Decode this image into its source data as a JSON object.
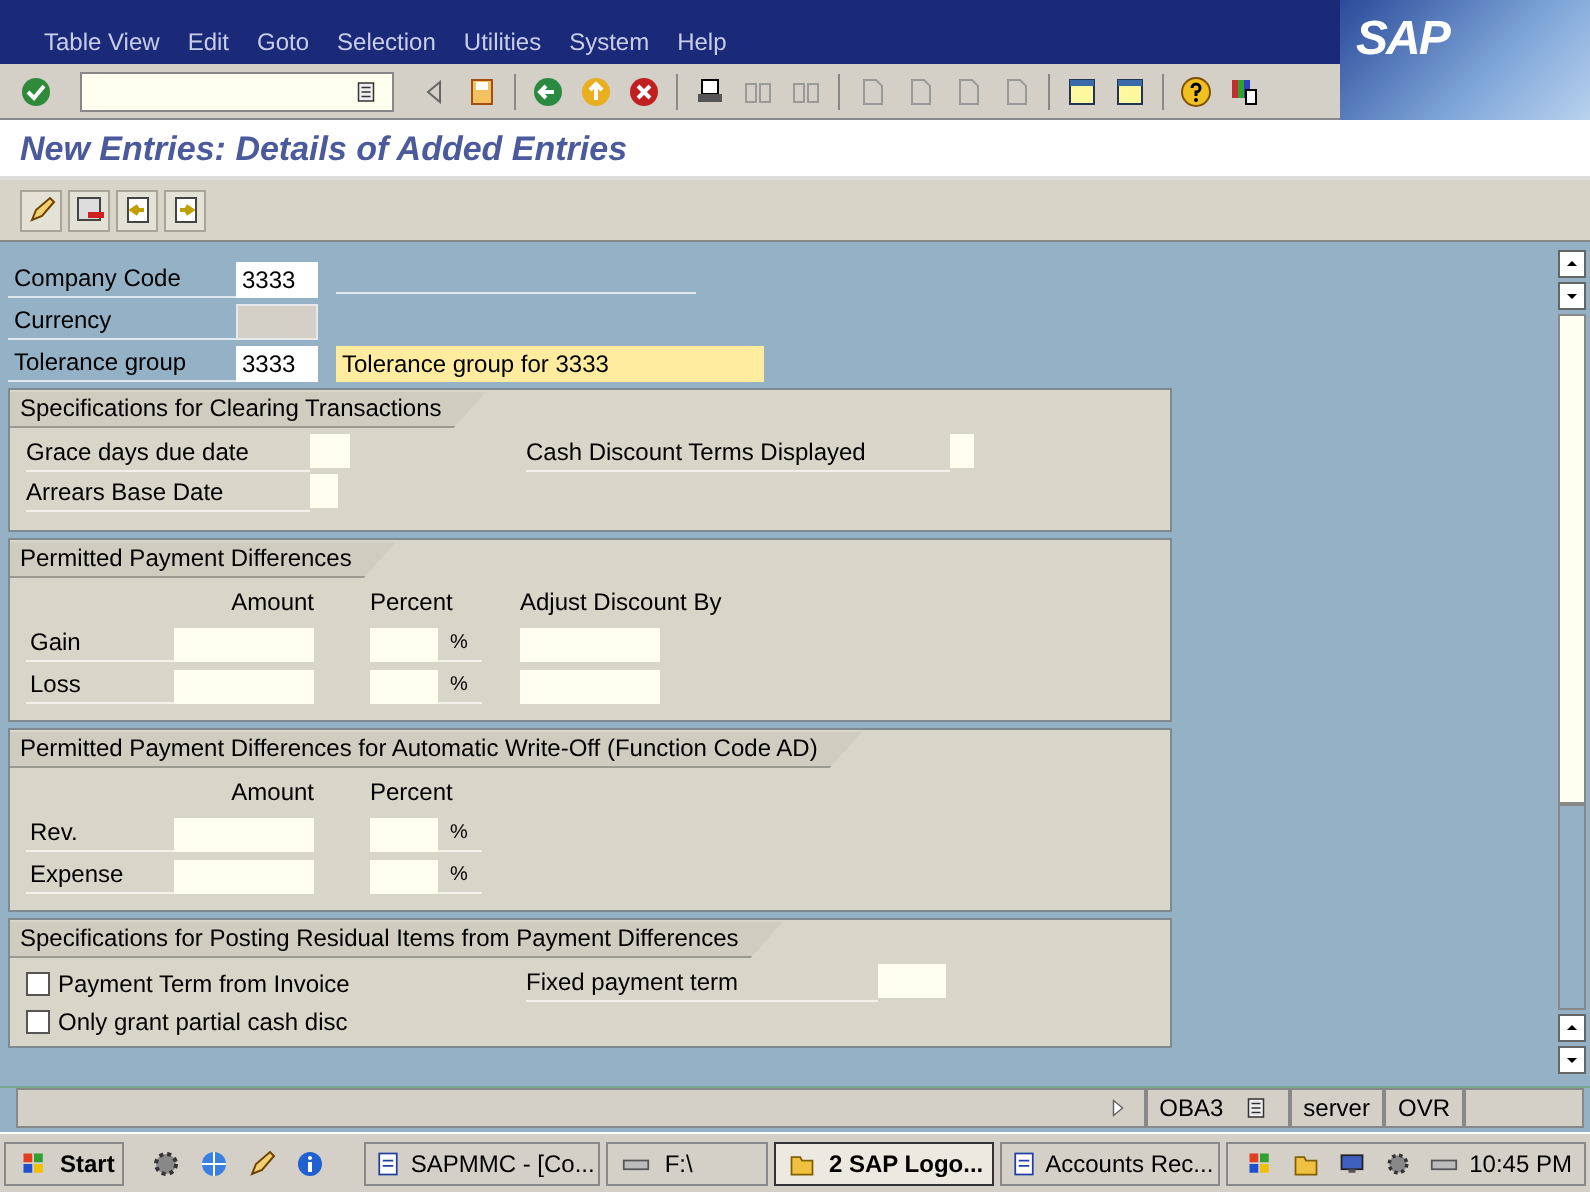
{
  "logo": "SAP",
  "menu_bar": [
    "Table View",
    "Edit",
    "Goto",
    "Selection",
    "Utilities",
    "System",
    "Help"
  ],
  "screen_title": "New Entries: Details of Added Entries",
  "header_fields": [
    {
      "kind": "line",
      "label": "Company Code",
      "value": "3333"
    },
    {
      "kind": "readonly",
      "label": "Currency"
    },
    {
      "kind": "described",
      "label": "Tolerance group",
      "value": "3333",
      "description": "Tolerance group for 3333"
    }
  ],
  "sections": [
    {
      "kind": "fields",
      "title": "Specifications for Clearing Transactions",
      "left": [
        "Grace days due date",
        "Arrears Base Date"
      ],
      "right": [
        "Cash Discount Terms Displayed"
      ]
    },
    {
      "kind": "grid",
      "title": "Permitted Payment Differences",
      "columns": [
        "Amount",
        "Percent",
        "Adjust Discount By"
      ],
      "rows": [
        "Gain",
        "Loss"
      ],
      "unit": "%"
    },
    {
      "kind": "grid",
      "title": "Permitted Payment Differences for Automatic Write-Off (Function Code AD)",
      "columns": [
        "Amount",
        "Percent"
      ],
      "rows": [
        "Rev.",
        "Expense"
      ],
      "unit": "%"
    },
    {
      "kind": "checks",
      "title": "Specifications for Posting Residual Items from Payment Differences",
      "checkboxes": [
        {
          "label": "Payment Term from Invoice",
          "checked": false
        },
        {
          "label": "Only grant partial cash disc",
          "checked": false
        }
      ],
      "right": [
        "Fixed payment term"
      ]
    }
  ],
  "status_bar": {
    "transaction": "OBA3",
    "server": "server",
    "mode": "OVR"
  },
  "taskbar": {
    "start": "Start",
    "tasks": [
      {
        "label": "SAPMMC - [Co...",
        "selected": false
      },
      {
        "label": "F:\\",
        "selected": false
      },
      {
        "label": "2 SAP Logo...",
        "selected": true
      },
      {
        "label": "Accounts Rec...",
        "selected": false
      }
    ],
    "clock": "10:45 PM"
  }
}
